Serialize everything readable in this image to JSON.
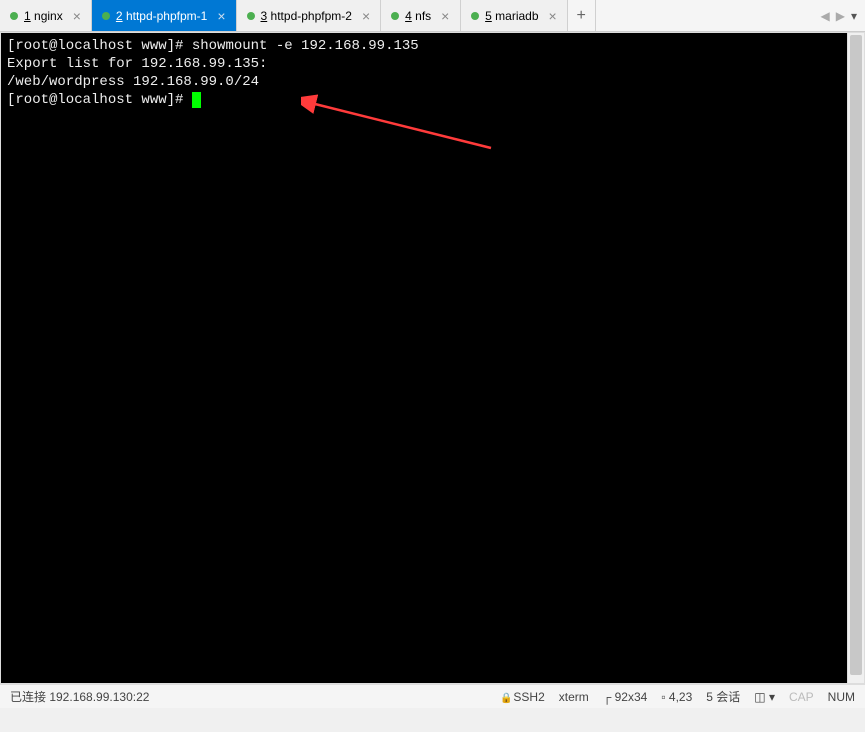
{
  "tabs": {
    "items": [
      {
        "num": "1",
        "label": "nginx"
      },
      {
        "num": "2",
        "label": "httpd-phpfpm-1"
      },
      {
        "num": "3",
        "label": "httpd-phpfpm-2"
      },
      {
        "num": "4",
        "label": "nfs"
      },
      {
        "num": "5",
        "label": "mariadb"
      }
    ],
    "add": "+"
  },
  "terminal": {
    "line1_prompt": "[root@localhost www]# ",
    "line1_cmd": "showmount -e 192.168.99.135",
    "line2": "Export list for 192.168.99.135:",
    "line3": "/web/wordpress 192.168.99.0/24",
    "line4_prompt": "[root@localhost www]# "
  },
  "status": {
    "connected": "已连接 192.168.99.130:22",
    "ssh": "SSH2",
    "term": "xterm",
    "size": "92x34",
    "pos": "4,23",
    "sessions": "5 会话",
    "cap": "CAP",
    "num": "NUM"
  }
}
